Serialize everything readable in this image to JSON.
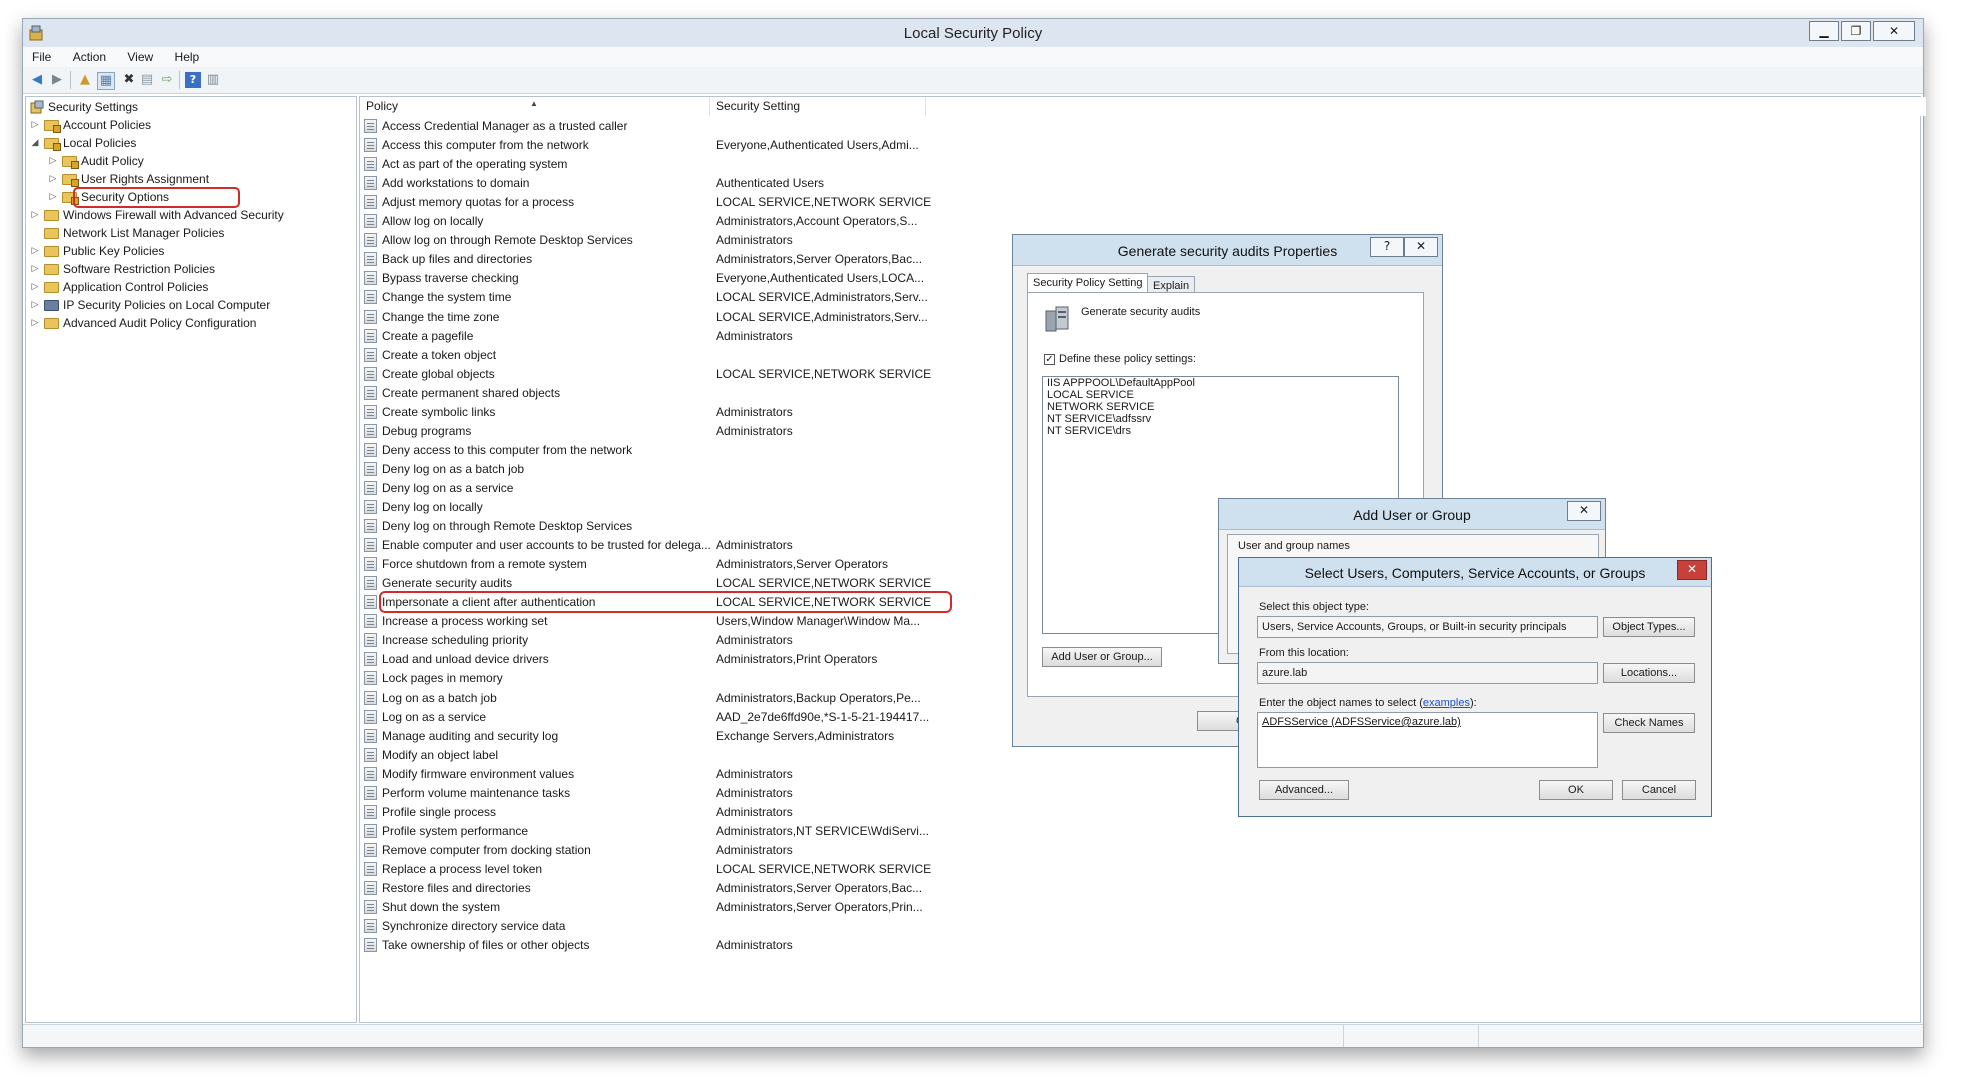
{
  "window": {
    "title": "Local Security Policy",
    "controls": {
      "minimize": "▁",
      "restore": "❐",
      "close": "✕"
    }
  },
  "menu": [
    "File",
    "Action",
    "View",
    "Help"
  ],
  "tree": {
    "root": "Security Settings",
    "items": [
      {
        "label": "Account Policies",
        "expander": "▷"
      },
      {
        "label": "Local Policies",
        "expander": "◢"
      },
      {
        "label": "Audit Policy",
        "expander": "▷"
      },
      {
        "label": "User Rights Assignment",
        "expander": "▷"
      },
      {
        "label": "Security Options",
        "expander": "▷"
      },
      {
        "label": "Windows Firewall with Advanced Security",
        "expander": "▷"
      },
      {
        "label": "Network List Manager Policies",
        "expander": ""
      },
      {
        "label": "Public Key Policies",
        "expander": "▷"
      },
      {
        "label": "Software Restriction Policies",
        "expander": "▷"
      },
      {
        "label": "Application Control Policies",
        "expander": "▷"
      },
      {
        "label": "IP Security Policies on Local Computer",
        "expander": "▷"
      },
      {
        "label": "Advanced Audit Policy Configuration",
        "expander": "▷"
      }
    ]
  },
  "list": {
    "columns": [
      "Policy",
      "Security Setting"
    ],
    "sort_arrow": "▲",
    "rows": [
      {
        "policy": "Access Credential Manager as a trusted caller",
        "setting": ""
      },
      {
        "policy": "Access this computer from the network",
        "setting": "Everyone,Authenticated Users,Admi..."
      },
      {
        "policy": "Act as part of the operating system",
        "setting": ""
      },
      {
        "policy": "Add workstations to domain",
        "setting": "Authenticated Users"
      },
      {
        "policy": "Adjust memory quotas for a process",
        "setting": "LOCAL SERVICE,NETWORK SERVICE,..."
      },
      {
        "policy": "Allow log on locally",
        "setting": "Administrators,Account Operators,S..."
      },
      {
        "policy": "Allow log on through Remote Desktop Services",
        "setting": "Administrators"
      },
      {
        "policy": "Back up files and directories",
        "setting": "Administrators,Server Operators,Bac..."
      },
      {
        "policy": "Bypass traverse checking",
        "setting": "Everyone,Authenticated Users,LOCA..."
      },
      {
        "policy": "Change the system time",
        "setting": "LOCAL SERVICE,Administrators,Serv..."
      },
      {
        "policy": "Change the time zone",
        "setting": "LOCAL SERVICE,Administrators,Serv..."
      },
      {
        "policy": "Create a pagefile",
        "setting": "Administrators"
      },
      {
        "policy": "Create a token object",
        "setting": ""
      },
      {
        "policy": "Create global objects",
        "setting": "LOCAL SERVICE,NETWORK SERVICE,..."
      },
      {
        "policy": "Create permanent shared objects",
        "setting": ""
      },
      {
        "policy": "Create symbolic links",
        "setting": "Administrators"
      },
      {
        "policy": "Debug programs",
        "setting": "Administrators"
      },
      {
        "policy": "Deny access to this computer from the network",
        "setting": ""
      },
      {
        "policy": "Deny log on as a batch job",
        "setting": ""
      },
      {
        "policy": "Deny log on as a service",
        "setting": ""
      },
      {
        "policy": "Deny log on locally",
        "setting": ""
      },
      {
        "policy": "Deny log on through Remote Desktop Services",
        "setting": ""
      },
      {
        "policy": "Enable computer and user accounts to be trusted for delega...",
        "setting": "Administrators"
      },
      {
        "policy": "Force shutdown from a remote system",
        "setting": "Administrators,Server Operators"
      },
      {
        "policy": "Generate security audits",
        "setting": "LOCAL SERVICE,NETWORK SERVICE,..."
      },
      {
        "policy": "Impersonate a client after authentication",
        "setting": "LOCAL SERVICE,NETWORK SERVICE,..."
      },
      {
        "policy": "Increase a process working set",
        "setting": "Users,Window Manager\\Window Ma..."
      },
      {
        "policy": "Increase scheduling priority",
        "setting": "Administrators"
      },
      {
        "policy": "Load and unload device drivers",
        "setting": "Administrators,Print Operators"
      },
      {
        "policy": "Lock pages in memory",
        "setting": ""
      },
      {
        "policy": "Log on as a batch job",
        "setting": "Administrators,Backup Operators,Pe..."
      },
      {
        "policy": "Log on as a service",
        "setting": "AAD_2e7de6ffd90e,*S-1-5-21-194417..."
      },
      {
        "policy": "Manage auditing and security log",
        "setting": "Exchange Servers,Administrators"
      },
      {
        "policy": "Modify an object label",
        "setting": ""
      },
      {
        "policy": "Modify firmware environment values",
        "setting": "Administrators"
      },
      {
        "policy": "Perform volume maintenance tasks",
        "setting": "Administrators"
      },
      {
        "policy": "Profile single process",
        "setting": "Administrators"
      },
      {
        "policy": "Profile system performance",
        "setting": "Administrators,NT SERVICE\\WdiServi..."
      },
      {
        "policy": "Remove computer from docking station",
        "setting": "Administrators"
      },
      {
        "policy": "Replace a process level token",
        "setting": "LOCAL SERVICE,NETWORK SERVICE,I..."
      },
      {
        "policy": "Restore files and directories",
        "setting": "Administrators,Server Operators,Bac..."
      },
      {
        "policy": "Shut down the system",
        "setting": "Administrators,Server Operators,Prin..."
      },
      {
        "policy": "Synchronize directory service data",
        "setting": ""
      },
      {
        "policy": "Take ownership of files or other objects",
        "setting": "Administrators"
      }
    ]
  },
  "props_dialog": {
    "title": "Generate security audits Properties",
    "help": "?",
    "close": "✕",
    "tabs": [
      "Security Policy Setting",
      "Explain"
    ],
    "policy_name": "Generate security audits",
    "define_checkbox": "Define these policy settings:",
    "define_checked": "✓",
    "accounts": [
      "IIS APPPOOL\\DefaultAppPool",
      "LOCAL SERVICE",
      "NETWORK SERVICE",
      "NT SERVICE\\adfssrv",
      "NT SERVICE\\drs"
    ],
    "add_button": "Add User or Group...",
    "ok_partial": "Ok"
  },
  "add_dialog": {
    "title": "Add User or Group",
    "close": "✕",
    "field_label": "User and group names"
  },
  "select_dialog": {
    "title": "Select Users, Computers, Service Accounts, or Groups",
    "close": "✕",
    "object_type_label": "Select this object type:",
    "object_type_value": "Users, Service Accounts, Groups, or Built-in security principals",
    "object_types_button": "Object Types...",
    "location_label": "From this location:",
    "location_value": "azure.lab",
    "locations_button": "Locations...",
    "names_label_prefix": "Enter the object names to select (",
    "names_label_link": "examples",
    "names_label_suffix": "):",
    "names_value": "ADFSService (ADFSService@azure.lab)",
    "check_names_button": "Check Names",
    "advanced_button": "Advanced...",
    "ok_button": "OK",
    "cancel_button": "Cancel"
  },
  "colors": {
    "highlight": "#d32a2a",
    "dialog_title": "#cfe0ef",
    "select_close": "#c7403a",
    "link": "#1a4ec4"
  }
}
